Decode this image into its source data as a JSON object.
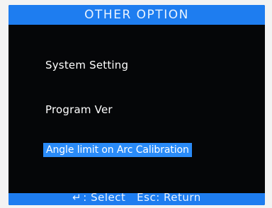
{
  "header": {
    "title": "OTHER OPTION"
  },
  "menu": {
    "items": [
      {
        "label": "System Setting",
        "selected": false
      },
      {
        "label": "Program Ver",
        "selected": false
      },
      {
        "label": "Angle limit on Arc Calibration",
        "selected": true
      }
    ]
  },
  "footer": {
    "select_icon": "enter-icon",
    "select_glyph": "↵",
    "select_label": ": Select",
    "return_label": "Esc: Return"
  },
  "colors": {
    "screen_background": "#050608",
    "bar_blue": "#1e7df0",
    "selection_blue": "#2a8bf8",
    "text": "#ffffff"
  }
}
